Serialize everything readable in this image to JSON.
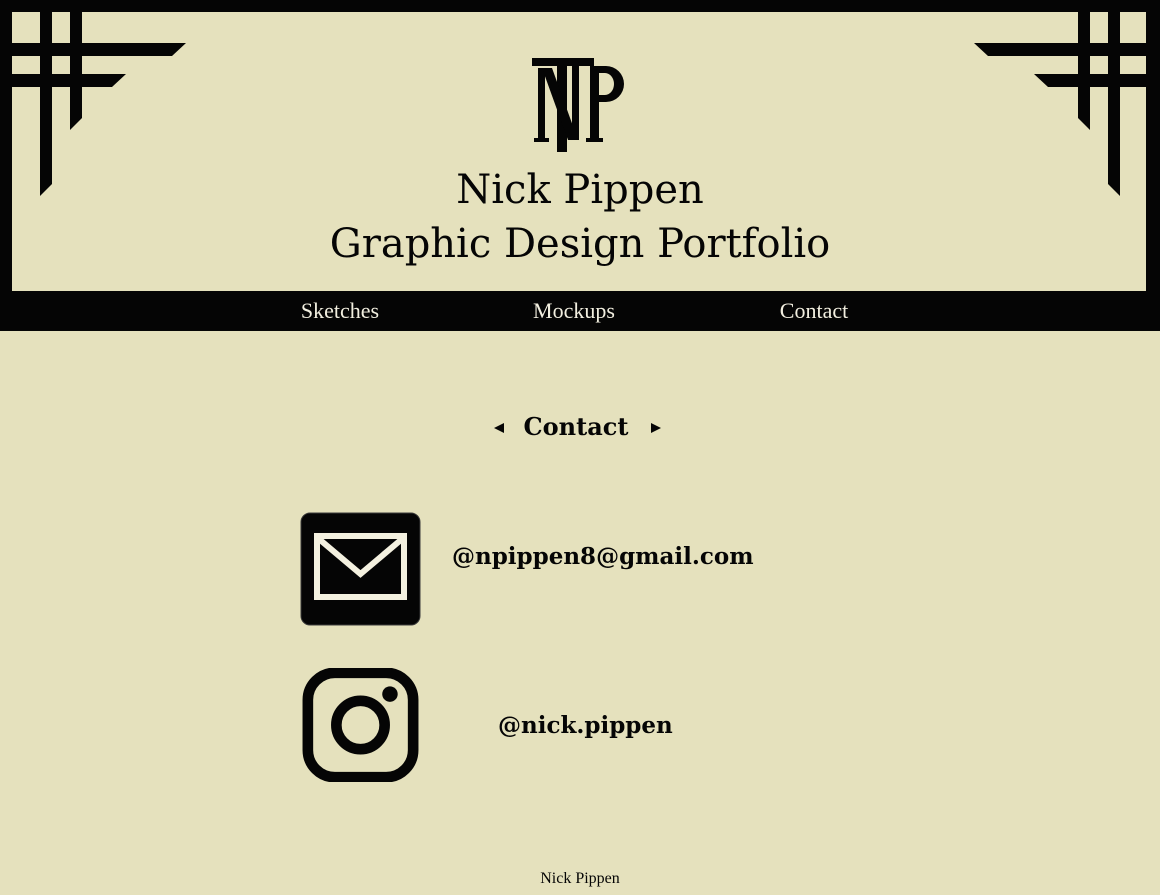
{
  "header": {
    "logo_letters": "NTP",
    "title": "Nick Pippen",
    "subtitle": "Graphic Design Portfolio"
  },
  "nav": {
    "items": [
      {
        "label": "Sketches"
      },
      {
        "label": "Mockups"
      },
      {
        "label": "Contact"
      }
    ]
  },
  "section": {
    "title": "Contact",
    "prev_icon": "triangle-left-icon",
    "next_icon": "triangle-right-icon"
  },
  "contacts": [
    {
      "icon": "envelope-icon",
      "text": "@npippen8@gmail.com"
    },
    {
      "icon": "instagram-icon",
      "text": "@nick.pippen"
    }
  ],
  "footer": {
    "text": "Nick Pippen"
  },
  "colors": {
    "background": "#e5e1bd",
    "ink": "#050505",
    "nav_text": "#f2efe0"
  }
}
